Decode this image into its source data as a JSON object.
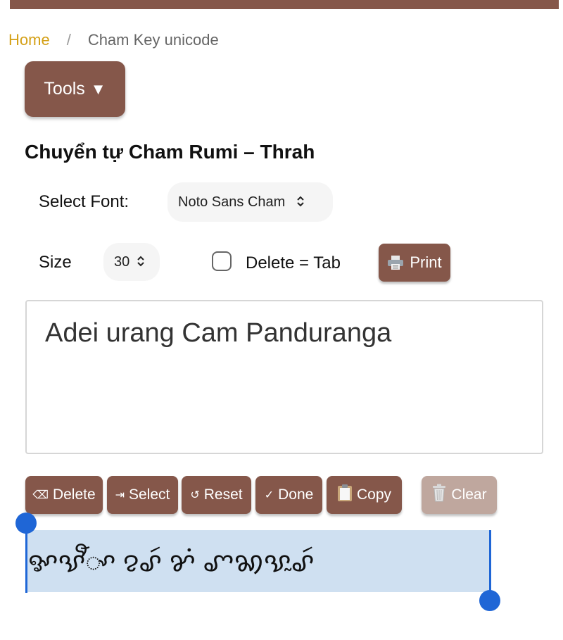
{
  "breadcrumb": {
    "home": "Home",
    "separator": "/",
    "current": "Cham Key unicode"
  },
  "tools": {
    "label": "Tools",
    "caret": "▼"
  },
  "page_title": "Chuyển tự Cham Rumi – Thrah",
  "font_select": {
    "label": "Select Font:",
    "value": "Noto Sans Cham"
  },
  "size_select": {
    "label": "Size",
    "value": "30"
  },
  "delete_tab": {
    "label": "Delete = Tab",
    "checked": false
  },
  "print": {
    "label": "Print"
  },
  "input_text": "Adei urang Cam Panduranga",
  "actions": {
    "delete": {
      "icon": "⌫",
      "label": "Delete"
    },
    "select": {
      "icon": "⇥",
      "label": "Select"
    },
    "reset": {
      "icon": "↺",
      "label": "Reset"
    },
    "done": {
      "icon": "✓",
      "label": "Done"
    },
    "copy": {
      "label": "Copy"
    },
    "clear": {
      "label": "Clear"
    }
  },
  "output_text": "ꨀꨕꨬꨳ ꨂꨣꩃ ꨌꩌ ꨚꩆꨕꨭꨣꩃ"
}
